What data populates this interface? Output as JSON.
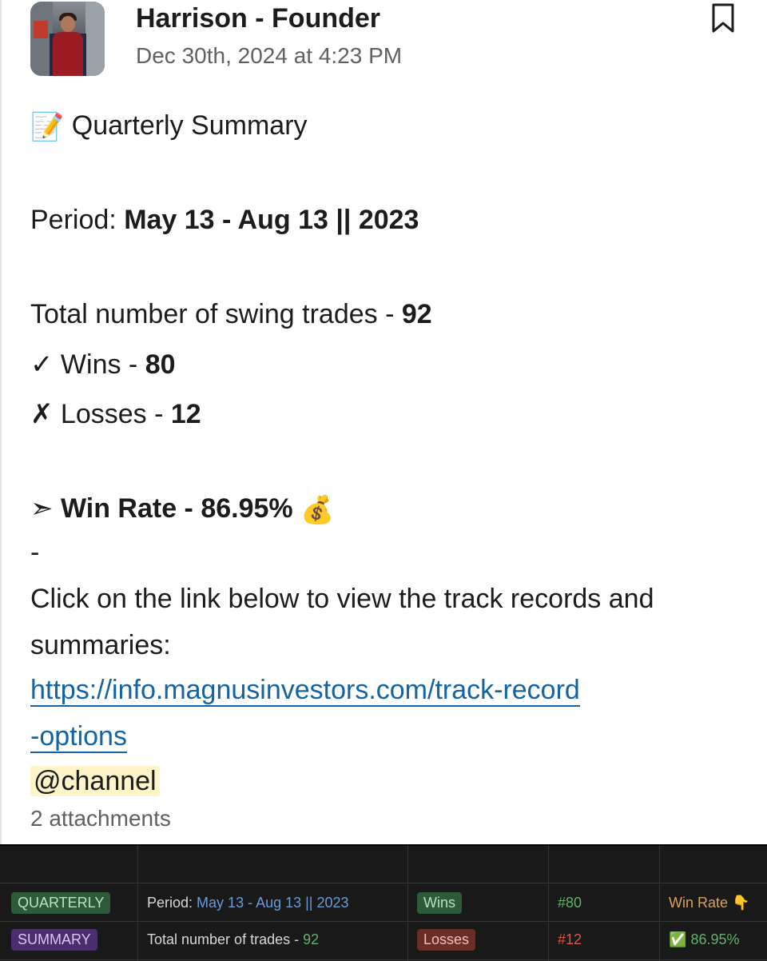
{
  "message": {
    "author": "Harrison - Founder",
    "timestamp": "Dec 30th, 2024 at 4:23 PM",
    "title_emoji": "📝",
    "title": "Quarterly Summary",
    "period_label": "Period: ",
    "period_value": "May 13 - Aug 13 || 2023",
    "total_label": "Total number of swing trades - ",
    "total_value": "92",
    "wins_label": "✓ Wins - ",
    "wins_value": "80",
    "losses_label": "✗ Losses - ",
    "losses_value": "12",
    "winrate_arrow": "➣",
    "winrate_text": "Win Rate - 86.95%",
    "winrate_emoji": "💰",
    "dash": "-",
    "cta_line1": "Click on the link below to view the track records and",
    "cta_line2": "summaries:",
    "link_line1": "https://info.magnusinvestors.com/track-record",
    "link_line2": "-options",
    "mention": "@channel",
    "attachments": "2 attachments"
  },
  "table": {
    "row1": {
      "tag": "QUARTERLY",
      "period_label": "Period: ",
      "period_value": "May 13 - Aug 13 || 2023",
      "result_tag": "Wins",
      "count": "#80",
      "metric": "Win Rate 👇"
    },
    "row2": {
      "tag": "SUMMARY",
      "trades_label": "Total number of trades - ",
      "trades_value": "92",
      "result_tag": "Losses",
      "count": "#12",
      "check": "✅",
      "metric": "86.95%"
    }
  },
  "colors": {
    "link": "#1264a3",
    "mention_bg": "#fdf4c8",
    "quarterly_tag": "#2e5a3a",
    "summary_tag": "#4a2e6e",
    "wins_tag": "#2e5a3a",
    "losses_tag": "#6a2e26",
    "period_blue": "#6a9bd8",
    "green_value": "#5fb36a",
    "red_value": "#d9584a",
    "winrate_orange": "#d9a35a"
  },
  "icons": [
    "bookmark-icon",
    "memo-icon",
    "arrow-icon",
    "money-bag-icon",
    "check-icon"
  ]
}
